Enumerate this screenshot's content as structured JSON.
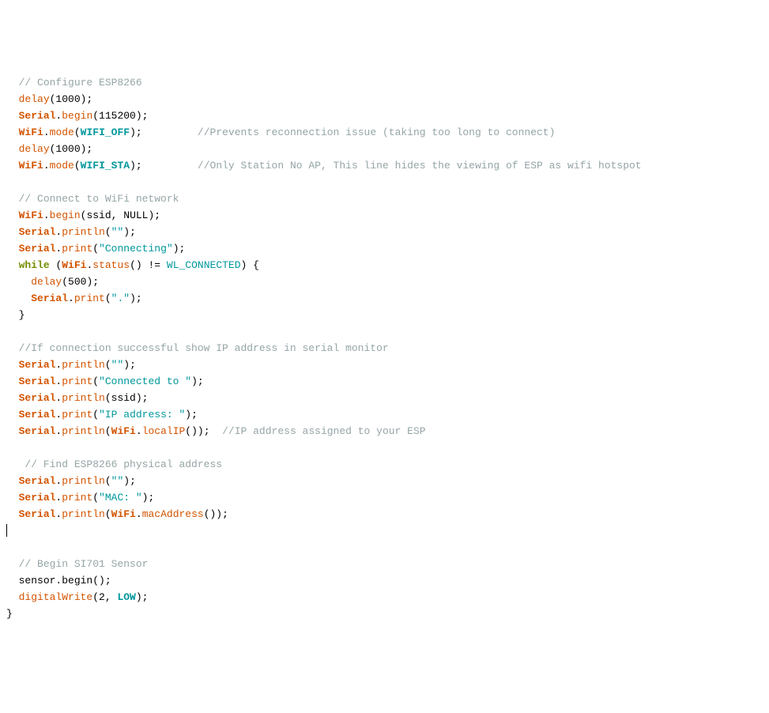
{
  "code": {
    "c_configure": "// Configure ESP8266",
    "delay": "delay",
    "n1000": "(1000);",
    "serial": "Serial",
    "begin": "begin",
    "n115200": "(115200);",
    "wifi": "WiFi",
    "mode": "mode",
    "wifi_off": "WIFI_OFF",
    "c_prevents": "//Prevents reconnection issue (taking too long to connect)",
    "wifi_sta": "WIFI_STA",
    "c_only_station": "//Only Station No AP, This line hides the viewing of ESP as wifi hotspot",
    "c_connect": "// Connect to WiFi network",
    "ssid_null": "(ssid, NULL);",
    "println": "println",
    "print": "print",
    "s_empty": "\"\"",
    "s_connecting": "\"Connecting\"",
    "while": "while",
    "status": "status",
    "wl_connected": "WL_CONNECTED",
    "n500": "(500);",
    "s_dot": "\".\"",
    "c_if_success": "//If connection successful show IP address in serial monitor",
    "s_connected_to": "\"Connected to \"",
    "ssid_arg": "(ssid);",
    "s_ip_address": "\"IP address: \"",
    "localip": "localIP",
    "c_ip_assigned": "//IP address assigned to your ESP",
    "c_find_physical": "// Find ESP8266 physical address",
    "s_mac": "\"MAC: \"",
    "macaddress": "macAddress",
    "c_begin_sensor": "// Begin SI701 Sensor",
    "sensor_begin": "sensor.begin();",
    "digitalwrite": "digitalWrite",
    "low": "LOW",
    "dw_args_open": "(2, ",
    "dw_args_close": ");",
    "open_paren": "(",
    "close_paren_semi": ");",
    "close_paren_semi2": "());",
    "dot": ".",
    "ne_op": "() != ",
    "close_brace_open": ") {",
    "close_brace": "}",
    "close_brace_final": "}",
    "spaces8": "        ",
    "spaces9": "         "
  }
}
